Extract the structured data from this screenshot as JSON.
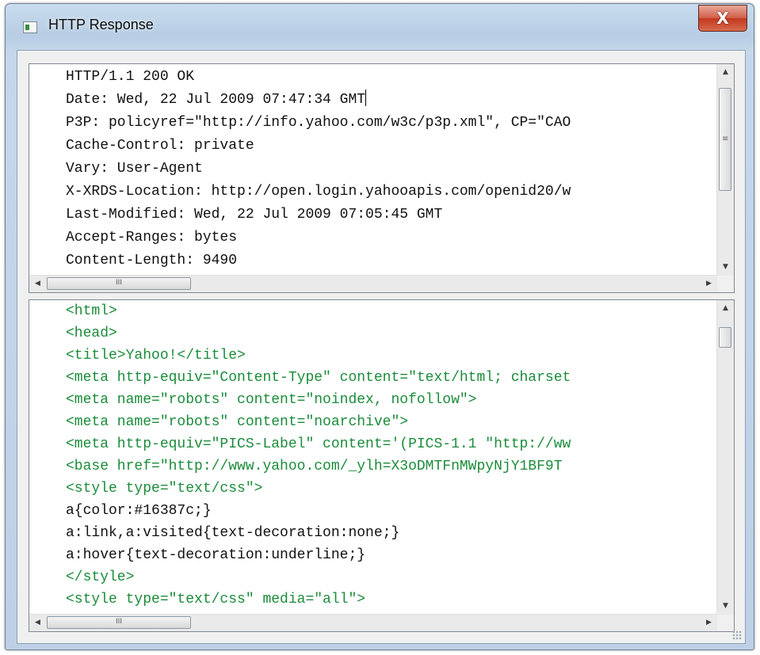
{
  "window": {
    "title": "HTTP Response",
    "close_glyph": "X"
  },
  "headers_pane": {
    "lines": [
      "HTTP/1.1 200 OK",
      "Date: Wed, 22 Jul 2009 07:47:34 GMT",
      "P3P: policyref=\"http://info.yahoo.com/w3c/p3p.xml\", CP=\"CAO",
      "Cache-Control: private",
      "Vary: User-Agent",
      "X-XRDS-Location: http://open.login.yahooapis.com/openid20/w",
      "Last-Modified: Wed, 22 Jul 2009 07:05:45 GMT",
      "Accept-Ranges: bytes",
      "Content-Length: 9490"
    ],
    "hscroll_thumb_glyph": "III"
  },
  "body_pane": {
    "lines": [
      "<html>",
      "<head>",
      "<title>Yahoo!</title>",
      "<meta http-equiv=\"Content-Type\" content=\"text/html; charset",
      "<meta name=\"robots\" content=\"noindex, nofollow\">",
      "<meta name=\"robots\" content=\"noarchive\">",
      "<meta http-equiv=\"PICS-Label\" content='(PICS-1.1 \"http://ww",
      "<base href=\"http://www.yahoo.com/_ylh=X3oDMTFnMWpyNjY1BF9T",
      "<style type=\"text/css\">",
      "a{color:#16387c;}",
      "a:link,a:visited{text-decoration:none;}",
      "a:hover{text-decoration:underline;}",
      "</style>",
      "<style type=\"text/css\" media=\"all\">"
    ],
    "hscroll_thumb_glyph": "III"
  },
  "icons": {
    "scroll_up": "up-arrow-icon",
    "scroll_down": "down-arrow-icon",
    "scroll_left": "left-arrow-icon",
    "scroll_right": "right-arrow-icon",
    "app": "app-window-icon",
    "close": "close-icon"
  },
  "colors": {
    "markup_text": "#1b8c3a",
    "plain_text": "#111111",
    "close_button": "#c3391f"
  }
}
